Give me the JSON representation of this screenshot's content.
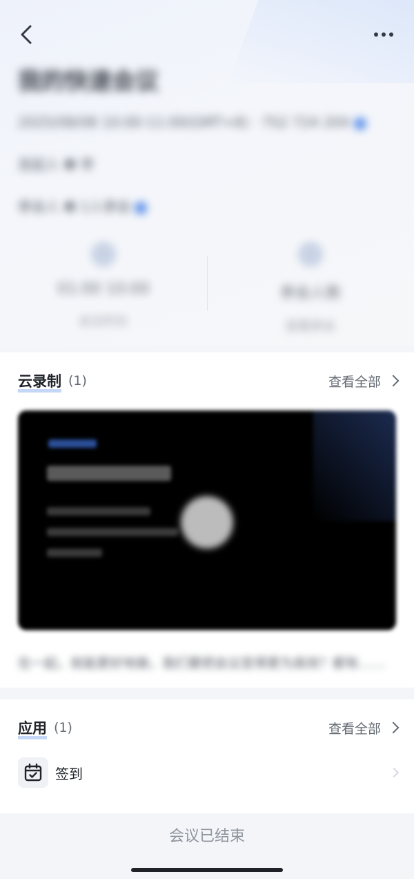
{
  "header": {
    "title": "我的快速会议",
    "info_line": "2025/08/08 10:00-11:00(GMT+8) · 752 724 204",
    "host_line": "发起人 ❶ 李",
    "attendees_line": "参会人 ❷ 1人参会",
    "stats": [
      {
        "value": "01:00 10:00",
        "label": "会议时长"
      },
      {
        "value": "参会人数",
        "label": "查看参会"
      }
    ]
  },
  "recording": {
    "title": "云录制",
    "count": "(1)",
    "view_all": "查看全部",
    "video": {
      "title": "我的快速会议"
    },
    "description": "在一起，就能更好地做，我们要把会议变得更为高效？都有……"
  },
  "apps": {
    "title": "应用",
    "count": "(1)",
    "view_all": "查看全部",
    "items": [
      {
        "label": "签到",
        "icon": "calendar-check-icon"
      }
    ]
  },
  "footer": {
    "status": "会议已结束"
  },
  "colors": {
    "accent": "#5b8fe8",
    "text_primary": "#1f2329",
    "text_secondary": "#646a73",
    "muted": "#8f959e"
  }
}
